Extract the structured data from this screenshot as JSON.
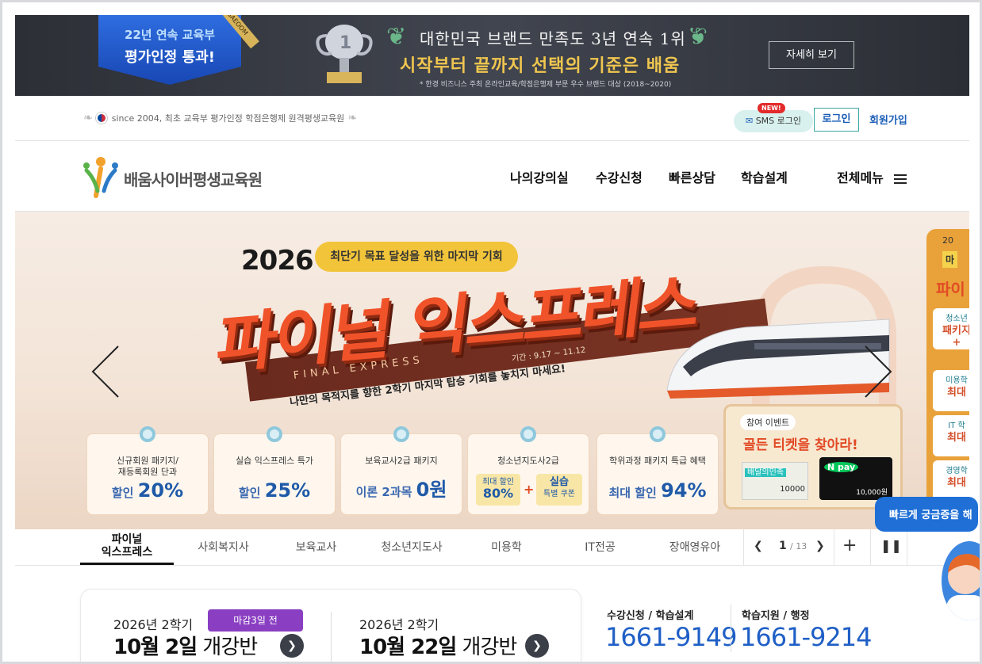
{
  "top_banner": {
    "shield_line1": "22년 연속 교육부",
    "shield_line2": "평가인정 통과!",
    "ribbon": "BAEOOM",
    "headline": "대한민국 브랜드 만족도 3년 연속 1위",
    "subline": "시작부터 끝까지 선택의 기준은 배움",
    "note": "* 한경 비즈니스 주최 온라인교육/학점은행제 부문 우수 브랜드 대상 (2018~2020)",
    "more_button": "자세히 보기"
  },
  "util": {
    "since": "since 2004, 최초 교육부 평가인정 학점은행제 원격평생교육원",
    "sms_new": "NEW!",
    "sms_label": "SMS 로그인",
    "login": "로그인",
    "join": "회원가입"
  },
  "nav": {
    "logo_text": "배움사이버평생교육원",
    "items": [
      "나의강의실",
      "수강신청",
      "빠른상담",
      "학습설계"
    ],
    "all_menu": "전체메뉴"
  },
  "hero": {
    "year": "2026",
    "pill": "최단기 목표 달성을 위한 마지막 기회",
    "title": "파이널 익스프레스",
    "english": "FINAL EXPRESS",
    "period": "기간 : 9.17 ~ 11.12",
    "subtitle": "나만의 목적지를 향한 2학기 마지막 탑승 기회를 놓치지 마세요!",
    "cards": [
      {
        "title": "신규회원 패키지/\n재등록회원 단과",
        "prefix": "할인 ",
        "value": "20%"
      },
      {
        "title": "실습 익스프레스 특가",
        "prefix": "할인 ",
        "value": "25%"
      },
      {
        "title": "보육교사2급 패키지",
        "prefix": "이론 2과목 ",
        "value": "0원"
      },
      {
        "title": "청소년지도사2급",
        "left_top": "최대 할인",
        "left_val": "80%",
        "plus": "+",
        "right_top": "실습",
        "right_bottom": "특별 쿠폰"
      },
      {
        "title": "학위과정 패키지 특급 혜택",
        "prefix": "최대 할인 ",
        "value": "94%"
      }
    ],
    "event": {
      "tag": "참여 이벤트",
      "headline": "골든 티켓을 찾아라!",
      "ticket1": "배달의민족",
      "ticket2": "10000",
      "npay": "N pay",
      "npay_amount": "10,000원"
    },
    "side": {
      "top": "20",
      "hd": "마",
      "big": "파이",
      "items": [
        {
          "line1": "청소년",
          "line2": "패키지",
          "line3": "+"
        },
        {
          "line1": "미용학",
          "line2": "최대"
        },
        {
          "line1": "IT 학",
          "line2": "최대"
        },
        {
          "line1": "경영학",
          "line2": "최대"
        }
      ]
    }
  },
  "tabs": {
    "items": [
      "파이널\n익스프레스",
      "사회복지사",
      "보육교사",
      "청소년지도사",
      "미용학",
      "IT전공",
      "장애영유아"
    ],
    "page_current": "1",
    "page_total": "/ 13"
  },
  "quick": {
    "label": "빠르게 궁금증을 해"
  },
  "openings": [
    {
      "semester": "2026년 2학기",
      "date": "10월 2일",
      "suffix": " 개강반",
      "deadline": "마감3일 전"
    },
    {
      "semester": "2026년 2학기",
      "date": "10월 22일",
      "suffix": " 개강반"
    }
  ],
  "contacts": [
    {
      "label": "수강신청 / 학습설계",
      "number": "1661-9149"
    },
    {
      "label": "학습지원 / 행정",
      "number": "1661-9214"
    }
  ],
  "colors": {
    "accent_blue": "#1f5fc6",
    "hero_orange": "#f0532a",
    "deadline_purple": "#8a3fc2"
  }
}
